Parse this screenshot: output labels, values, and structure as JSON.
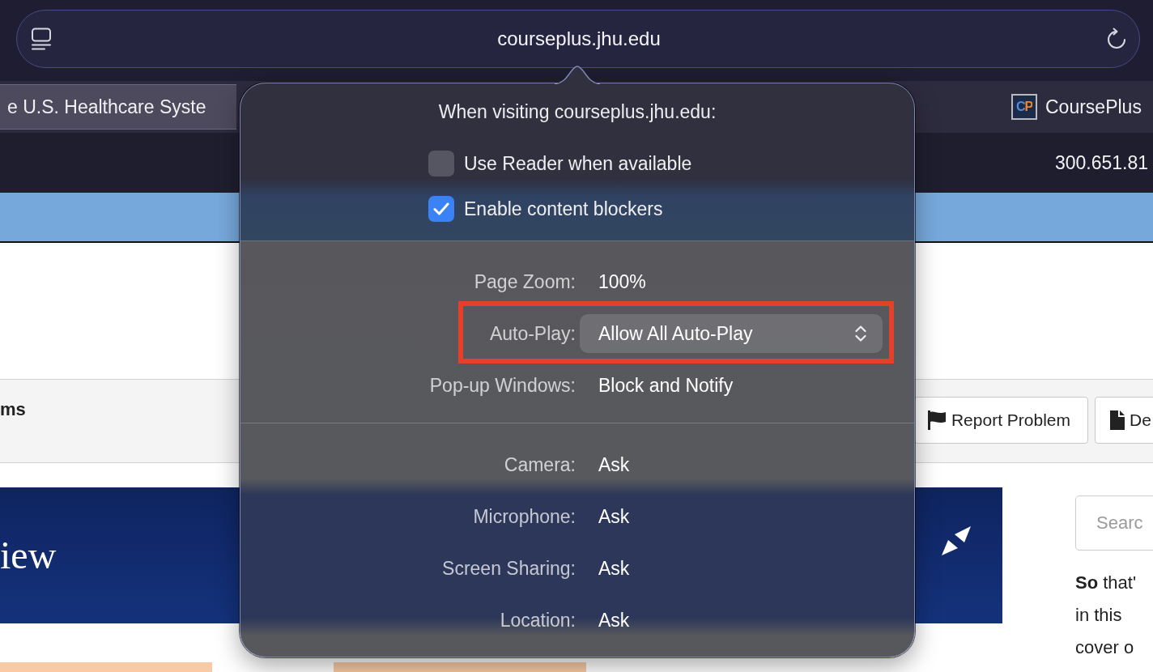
{
  "address_bar": {
    "url": "courseplus.jhu.edu"
  },
  "tabs": [
    {
      "title": "e U.S. Healthcare Syste",
      "selected": true
    },
    {
      "title": "CoursePlus",
      "favicon_text": "CP",
      "selected": false
    }
  ],
  "page": {
    "contact_number": "300.651.81",
    "toolbar": {
      "heading": "ms",
      "buttons": [
        {
          "label": "Report Problem",
          "kind": "flag"
        },
        {
          "label": "De",
          "kind": "document"
        }
      ]
    },
    "banner": {
      "title": "iew"
    },
    "search": {
      "placeholder": "Searc"
    },
    "body_text": "**So** that'\nin this\ncover o"
  },
  "site_popover": {
    "title": "When visiting courseplus.jhu.edu:",
    "options": [
      {
        "label": "Use Reader when available",
        "checked": false
      },
      {
        "label": "Enable content blockers",
        "checked": true
      }
    ],
    "settings": [
      {
        "label": "Page Zoom:",
        "value": "100%",
        "kind": "text",
        "highlighted": false
      },
      {
        "label": "Auto-Play:",
        "value": "Allow All Auto-Play",
        "kind": "popup",
        "highlighted": true
      },
      {
        "label": "Pop-up Windows:",
        "value": "Block and Notify",
        "kind": "text",
        "highlighted": false
      }
    ],
    "permissions": [
      {
        "label": "Camera:",
        "value": "Ask"
      },
      {
        "label": "Microphone:",
        "value": "Ask"
      },
      {
        "label": "Screen Sharing:",
        "value": "Ask"
      },
      {
        "label": "Location:",
        "value": "Ask"
      }
    ]
  }
}
